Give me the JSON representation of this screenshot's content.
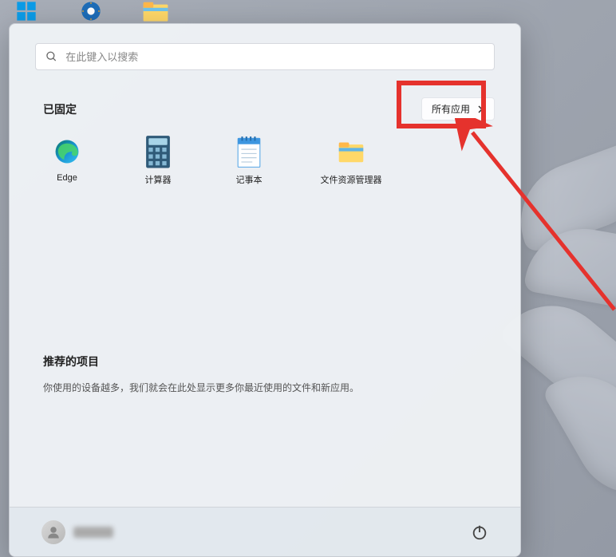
{
  "search": {
    "placeholder": "在此键入以搜索"
  },
  "pinned": {
    "title": "已固定",
    "allAppsLabel": "所有应用",
    "apps": [
      {
        "id": "edge",
        "label": "Edge"
      },
      {
        "id": "calculator",
        "label": "计算器"
      },
      {
        "id": "notepad",
        "label": "记事本"
      },
      {
        "id": "explorer",
        "label": "文件资源管理器"
      }
    ]
  },
  "recommended": {
    "title": "推荐的项目",
    "emptyText": "你使用的设备越多，我们就会在此处显示更多你最近使用的文件和新应用。"
  },
  "annotation": {
    "highlightColor": "#e5322d"
  }
}
